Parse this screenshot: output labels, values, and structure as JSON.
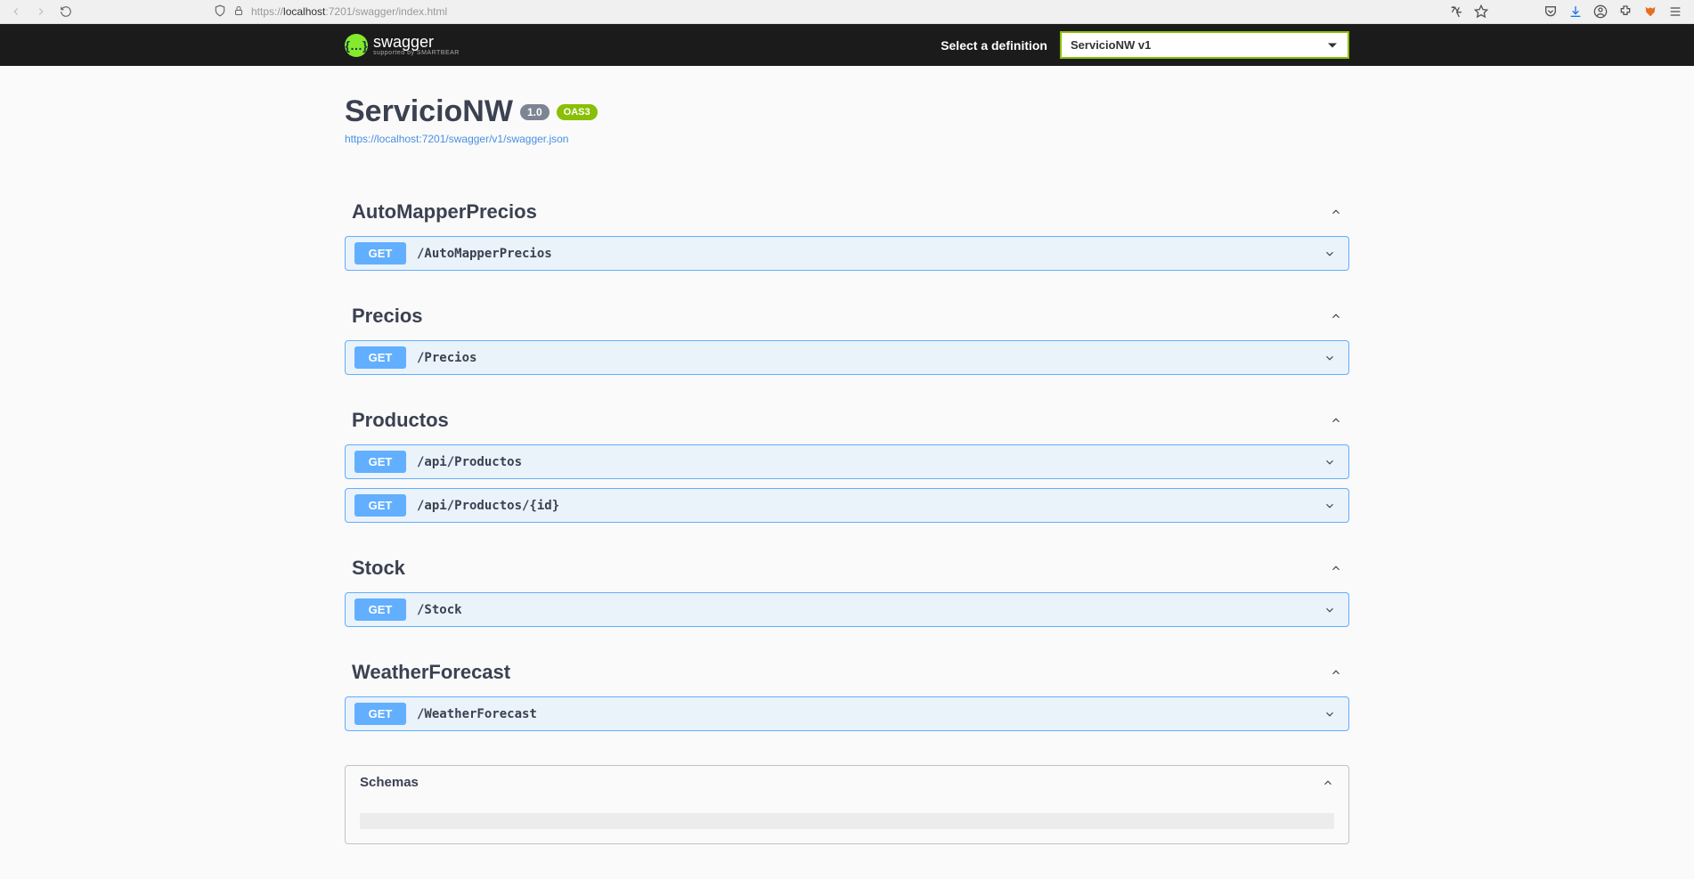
{
  "browser": {
    "url_prefix": "https://",
    "url_domain": "localhost",
    "url_rest": ":7201/swagger/index.html"
  },
  "header": {
    "logo_text": "swagger",
    "logo_sub": "supported by SMARTBEAR",
    "def_label": "Select a definition",
    "def_selected": "ServicioNW v1"
  },
  "info": {
    "title": "ServicioNW",
    "version": "1.0",
    "oas": "OAS3",
    "link": "https://localhost:7201/swagger/v1/swagger.json"
  },
  "tags": [
    {
      "name": "AutoMapperPrecios",
      "ops": [
        {
          "method": "GET",
          "path": "/AutoMapperPrecios"
        }
      ]
    },
    {
      "name": "Precios",
      "ops": [
        {
          "method": "GET",
          "path": "/Precios"
        }
      ]
    },
    {
      "name": "Productos",
      "ops": [
        {
          "method": "GET",
          "path": "/api/Productos"
        },
        {
          "method": "GET",
          "path": "/api/Productos/{id}"
        }
      ]
    },
    {
      "name": "Stock",
      "ops": [
        {
          "method": "GET",
          "path": "/Stock"
        }
      ]
    },
    {
      "name": "WeatherForecast",
      "ops": [
        {
          "method": "GET",
          "path": "/WeatherForecast"
        }
      ]
    }
  ],
  "schemas": {
    "title": "Schemas"
  }
}
